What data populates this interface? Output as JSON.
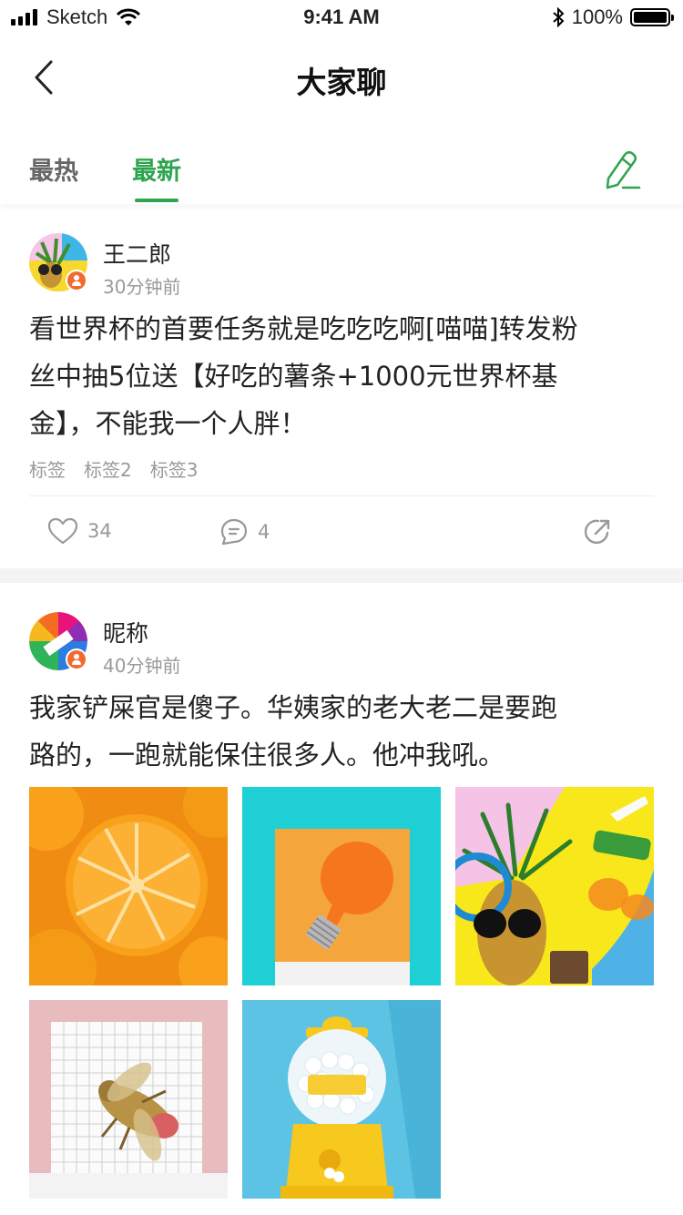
{
  "status_bar": {
    "carrier": "Sketch",
    "time": "9:41 AM",
    "battery": "100%"
  },
  "nav": {
    "title": "大家聊",
    "back_icon": "chevron-left-icon"
  },
  "tabs": [
    {
      "label": "最热",
      "active": false
    },
    {
      "label": "最新",
      "active": true
    }
  ],
  "accent_color": "#2ea44f",
  "posts": [
    {
      "author": "王二郎",
      "time": "30分钟前",
      "text_lines": [
        "看世界杯的首要任务就是吃吃吃啊[喵喵]转发粉",
        "丝中抽5位送【好吃的薯条+1000元世界杯基",
        "金】，不能我一个人胖！"
      ],
      "tags": [
        "标签",
        "标签2",
        "标签3"
      ],
      "likes": "34",
      "comments": "4"
    },
    {
      "author": "昵称",
      "time": "40分钟前",
      "text_lines": [
        "我家铲屎官是傻子。华姨家的老大老二是要跑",
        "路的，一跑就能保住很多人。他冲我吼。"
      ],
      "photos": [
        "orange-slices",
        "lightbulb-on-teal",
        "pineapple-sunglasses",
        "bee-brooch-on-grid",
        "candy-machine"
      ]
    }
  ]
}
